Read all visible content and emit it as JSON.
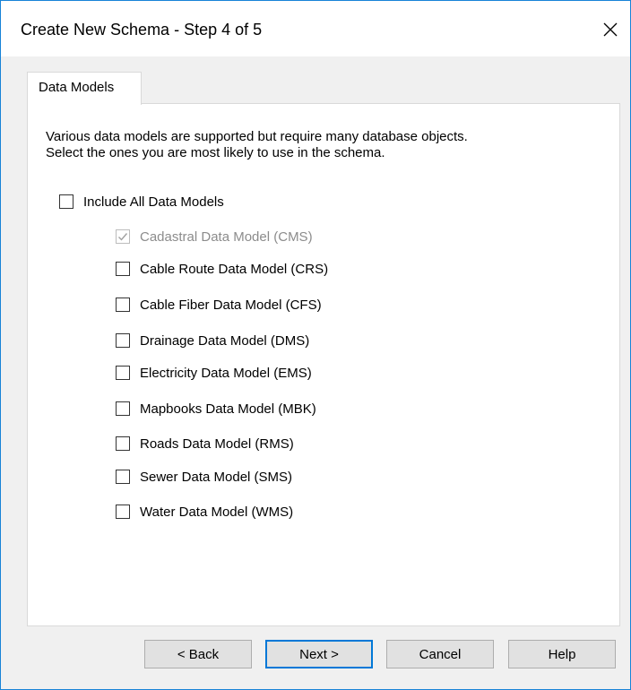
{
  "window": {
    "title": "Create New Schema - Step 4 of 5",
    "close_glyph": "✕"
  },
  "tabs": [
    {
      "label": "Data Models",
      "selected": true
    }
  ],
  "panel": {
    "intro_line1": "Various data models are supported but require many database objects.",
    "intro_line2": "Select the ones you are most likely to use in the schema.",
    "include_all": {
      "label": "Include All Data Models",
      "checked": false
    },
    "models": [
      {
        "label": "Cadastral Data Model (CMS)",
        "checked": true,
        "disabled": true
      },
      {
        "label": "Cable Route Data Model (CRS)",
        "checked": false,
        "disabled": false
      },
      {
        "label": "Cable Fiber Data Model (CFS)",
        "checked": false,
        "disabled": false
      },
      {
        "label": "Drainage Data Model (DMS)",
        "checked": false,
        "disabled": false
      },
      {
        "label": "Electricity Data Model (EMS)",
        "checked": false,
        "disabled": false
      },
      {
        "label": "Mapbooks Data Model (MBK)",
        "checked": false,
        "disabled": false
      },
      {
        "label": "Roads Data Model (RMS)",
        "checked": false,
        "disabled": false
      },
      {
        "label": "Sewer Data Model (SMS)",
        "checked": false,
        "disabled": false
      },
      {
        "label": "Water Data Model (WMS)",
        "checked": false,
        "disabled": false
      }
    ]
  },
  "buttons": {
    "back": "< Back",
    "next": "Next >",
    "cancel": "Cancel",
    "help": "Help"
  },
  "colors": {
    "window_border": "#1883d7",
    "dialog_background": "#f0f0f0",
    "default_button_border": "#0078d7",
    "disabled_text": "#8c8c8c",
    "disabled_check": "#a0a0a0"
  },
  "icons": {
    "close": "close-icon",
    "check": "checkmark-icon"
  }
}
